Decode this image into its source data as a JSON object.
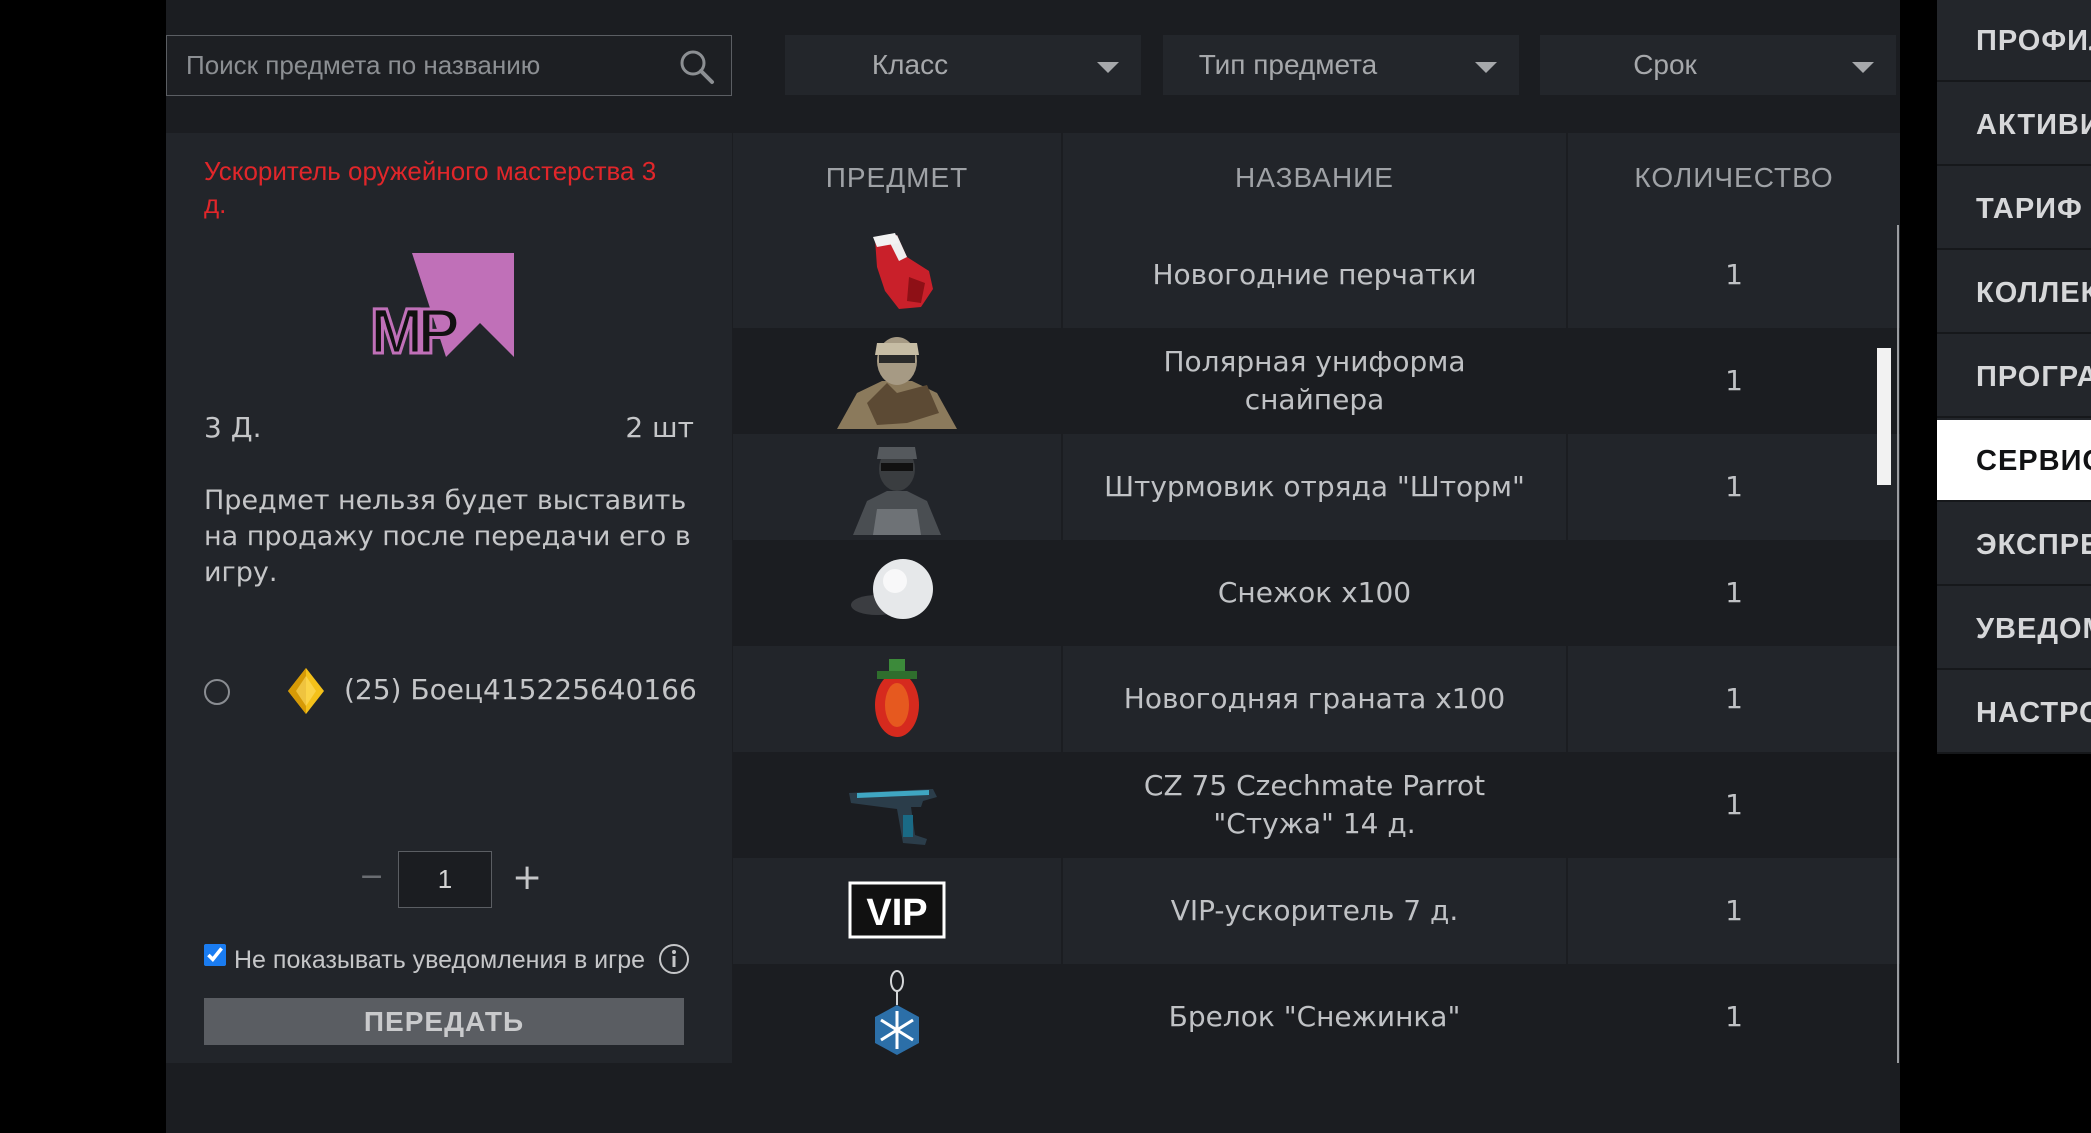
{
  "search": {
    "placeholder": "Поиск предмета по названию"
  },
  "filters": {
    "class_label": "Класс",
    "type_label": "Тип предмета",
    "term_label": "Срок"
  },
  "selected": {
    "title": "Ускоритель оружейного мастерства 3 д.",
    "icon_text": "MP",
    "duration": "3 Д.",
    "count": "2 шт",
    "description": "Предмет нельзя будет выставить на продажу после передачи его в игру.",
    "player": "(25) Боец415225640166",
    "quantity_minus": "−",
    "quantity": "1",
    "quantity_plus": "+",
    "hide_notifications": "Не показывать уведомления в игре",
    "send_button": "ПЕРЕДАТЬ"
  },
  "table": {
    "headers": {
      "item": "ПРЕДМЕТ",
      "name": "НАЗВАНИЕ",
      "qty": "КОЛИЧЕСТВО"
    },
    "rows": [
      {
        "name": "Новогодние перчатки",
        "qty": "1",
        "icon": "gloves-icon"
      },
      {
        "name": "Полярная униформа снайпера",
        "qty": "1",
        "icon": "sniper-uniform-icon"
      },
      {
        "name": "Штурмовик отряда \"Шторм\"",
        "qty": "1",
        "icon": "stormtrooper-icon"
      },
      {
        "name": "Снежок х100",
        "qty": "1",
        "icon": "snowball-icon"
      },
      {
        "name": "Новогодняя граната х100",
        "qty": "1",
        "icon": "grenade-icon"
      },
      {
        "name": "CZ 75 Czechmate Parrot \"Стужа\" 14 д.",
        "qty": "1",
        "icon": "pistol-icon"
      },
      {
        "name": "VIP-ускоритель 7 д.",
        "qty": "1",
        "icon": "vip-icon",
        "icon_text": "VIP"
      },
      {
        "name": "Брелок \"Снежинка\"",
        "qty": "1",
        "icon": "snowflake-charm-icon"
      }
    ]
  },
  "nav": {
    "items": [
      "ПРОФИЛЬ",
      "АКТИВИРОВАТЬ",
      "ТАРИФ",
      "КОЛЛЕКЦИИ",
      "ПРОГРАММЫ",
      "СЕРВИСЫ",
      "ЭКСПРЕСС",
      "УВЕДОМЛЕНИЯ",
      "НАСТРОЙКИ"
    ],
    "active_index": 5
  },
  "colors": {
    "accent_red": "#e1262a",
    "checkbox": "#1a7cf1",
    "mp_pink": "#c070b8"
  }
}
